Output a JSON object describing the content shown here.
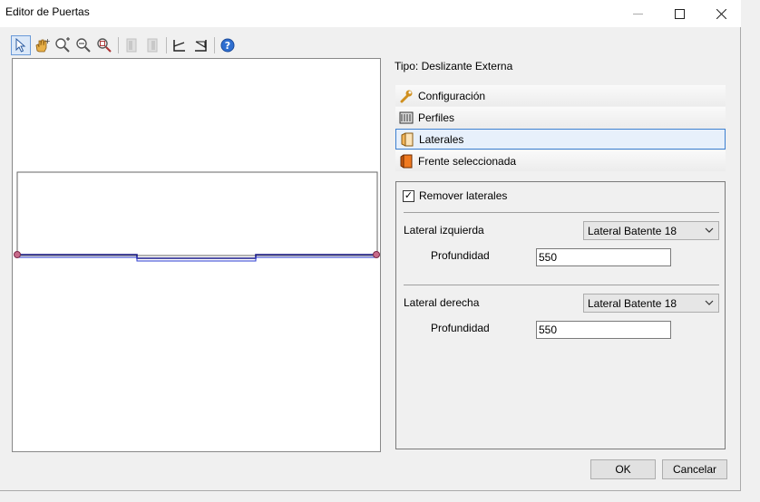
{
  "window": {
    "title": "Editor de Puertas"
  },
  "toolbar": {
    "buttons": [
      {
        "icon": "select-pointer-icon"
      },
      {
        "icon": "pan-hand-icon"
      },
      {
        "icon": "zoom-in-icon"
      },
      {
        "icon": "zoom-out-icon"
      },
      {
        "icon": "zoom-extents-icon"
      },
      {
        "icon": "left-profile-icon"
      },
      {
        "icon": "right-profile-icon"
      },
      {
        "icon": "left-angle-icon"
      },
      {
        "icon": "right-angle-icon"
      },
      {
        "icon": "help-icon"
      }
    ]
  },
  "info": {
    "tipo": "Tipo: Deslizante Externa"
  },
  "sections": [
    {
      "label": "Configuración",
      "icon": "wrench-icon"
    },
    {
      "label": "Perfiles",
      "icon": "profiles-icon"
    },
    {
      "label": "Laterales",
      "icon": "laterals-icon"
    },
    {
      "label": "Frente seleccionada",
      "icon": "front-icon"
    }
  ],
  "laterales": {
    "remove_label": "Remover laterales",
    "remove_checked": true,
    "left": {
      "label": "Lateral izquierda",
      "select": "Lateral Batente 18",
      "depth_label": "Profundidad",
      "depth": "550"
    },
    "right": {
      "label": "Lateral derecha",
      "select": "Lateral Batente 18",
      "depth_label": "Profundidad",
      "depth": "550"
    }
  },
  "buttons": {
    "ok": "OK",
    "cancel": "Cancelar"
  }
}
